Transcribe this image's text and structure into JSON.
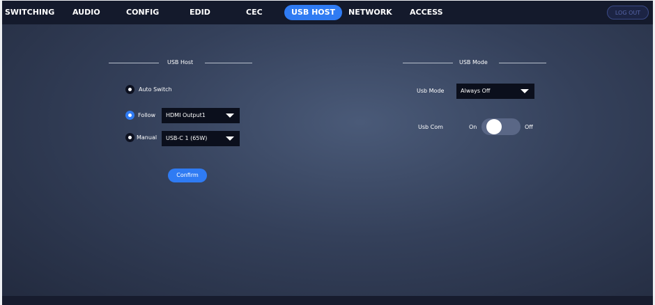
{
  "nav": {
    "tabs": [
      {
        "label": "SWITCHING"
      },
      {
        "label": "AUDIO"
      },
      {
        "label": "CONFIG"
      },
      {
        "label": "EDID"
      },
      {
        "label": "CEC"
      },
      {
        "label": "USB HOST"
      },
      {
        "label": "NETWORK"
      },
      {
        "label": "ACCESS"
      }
    ],
    "active_tab": "USB HOST",
    "logout_label": "LOG OUT"
  },
  "usb_host": {
    "title": "USB Host",
    "auto_switch_label": "Auto Switch",
    "follow_label": "Follow",
    "follow_value": "HDMI Output1",
    "manual_label": "Manual",
    "manual_value": "USB-C 1 (65W)",
    "selected_option": "Follow",
    "confirm_label": "Confirm"
  },
  "usb_mode": {
    "title": "USB Mode",
    "mode_label": "Usb Mode",
    "mode_value": "Always Off",
    "com_label": "Usb Com",
    "com_on_label": "On",
    "com_off_label": "Off",
    "com_state": "Off"
  },
  "colors": {
    "accent": "#2f7bf3",
    "navbar": "#141a2c",
    "background": "#34405a"
  },
  "icons": {
    "dropdown": "caret-down-icon"
  }
}
